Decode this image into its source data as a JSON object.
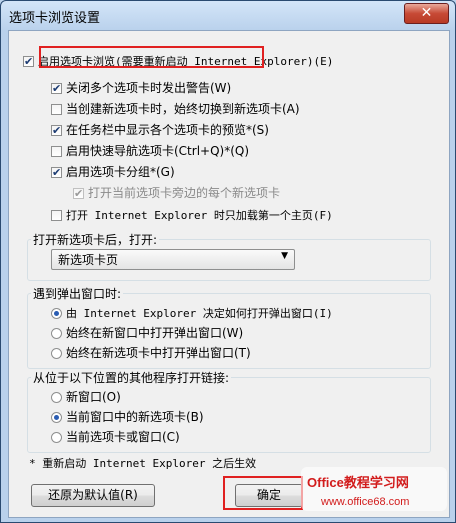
{
  "window": {
    "title": "选项卡浏览设置",
    "close_label": "✕"
  },
  "options": [
    {
      "label": "启用选项卡浏览(需要重新启动 Internet Explorer)(E)",
      "checked": true
    },
    {
      "label": "关闭多个选项卡时发出警告(W)",
      "checked": true
    },
    {
      "label": "当创建新选项卡时，始终切换到新选项卡(A)",
      "checked": false
    },
    {
      "label": "在任务栏中显示各个选项卡的预览*(S)",
      "checked": true
    },
    {
      "label": "启用快速导航选项卡(Ctrl+Q)*(Q)",
      "checked": false
    },
    {
      "label": "启用选项卡分组*(G)",
      "checked": true
    },
    {
      "label": "打开当前选项卡旁边的每个新选项卡",
      "checked": true,
      "disabled": true
    },
    {
      "label": "打开 Internet Explorer 时只加载第一个主页(F)",
      "checked": false
    }
  ],
  "new_tab": {
    "label": "打开新选项卡后，打开:",
    "value": "新选项卡页"
  },
  "popup": {
    "label": "遇到弹出窗口时:",
    "options": [
      "由 Internet Explorer 决定如何打开弹出窗口(I)",
      "始终在新窗口中打开弹出窗口(W)",
      "始终在新选项卡中打开弹出窗口(T)"
    ],
    "selected": 0
  },
  "links": {
    "label": "从位于以下位置的其他程序打开链接:",
    "options": [
      "新窗口(O)",
      "当前窗口中的新选项卡(B)",
      "当前选项卡或窗口(C)"
    ],
    "selected": 1
  },
  "footnote": "* 重新启动 Internet Explorer 之后生效",
  "buttons": {
    "restore": "还原为默认值(R)",
    "ok": "确定"
  },
  "watermark": {
    "brand": "Office教程学习网",
    "url": "www.office68.com"
  },
  "colors": {
    "highlight": "#e02020",
    "watermark": "#d21c1c"
  }
}
